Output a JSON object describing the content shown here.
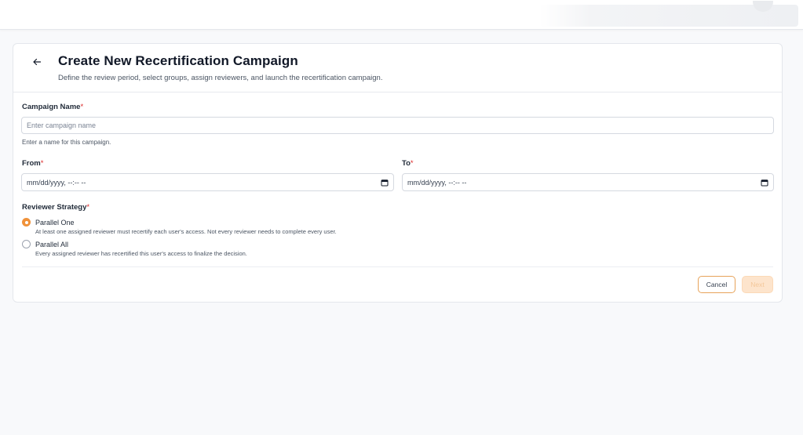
{
  "header": {
    "title": "Create New Recertification Campaign",
    "subtitle": "Define the review period, select groups, assign reviewers, and launch the recertification campaign."
  },
  "campaign_name": {
    "label": "Campaign Name",
    "required_mark": "*",
    "placeholder": "Enter campaign name",
    "value": "",
    "hint": "Enter a name for this campaign."
  },
  "from_field": {
    "label": "From",
    "required_mark": "*",
    "value": "mm/dd/yyyy, --:-- --"
  },
  "to_field": {
    "label": "To",
    "required_mark": "*",
    "value": "mm/dd/yyyy, --:-- --"
  },
  "reviewer_strategy": {
    "label": "Reviewer Strategy",
    "required_mark": "*",
    "options": [
      {
        "label": "Parallel One",
        "description": "At least one assigned reviewer must recertify each user's access. Not every reviewer needs to complete every user.",
        "selected": true
      },
      {
        "label": "Parallel All",
        "description": "Every assigned reviewer has recertified this user's access to finalize the decision.",
        "selected": false
      }
    ]
  },
  "actions": {
    "cancel_label": "Cancel",
    "next_label": "Next"
  },
  "icons": {
    "back": "arrow-left-icon",
    "calendar": "calendar-icon"
  },
  "colors": {
    "accent": "#f0923a",
    "next_disabled_bg": "#fde4cc",
    "required": "#dc2626"
  }
}
